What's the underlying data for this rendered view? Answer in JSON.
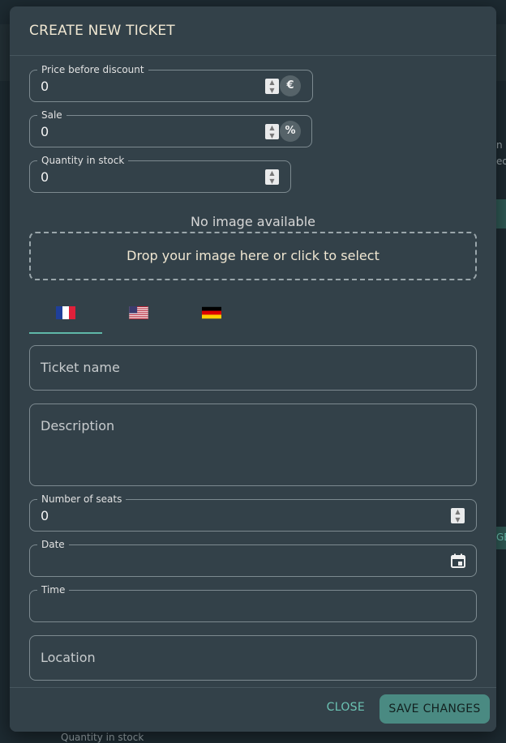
{
  "background": {
    "bottom_peek_label": "Quantity in stock",
    "right_peek_1": "n i",
    "right_peek_2": "ed",
    "right_peek_3": "GE"
  },
  "modal": {
    "title": "CREATE NEW TICKET",
    "price": {
      "label": "Price before discount",
      "value": "0",
      "adornment": "€"
    },
    "sale": {
      "label": "Sale",
      "value": "0",
      "adornment": "%"
    },
    "quantity": {
      "label": "Quantity in stock",
      "value": "0"
    },
    "no_image_text": "No image available",
    "dropzone_text": "Drop your image here or click to select",
    "language_tabs": [
      {
        "flag": "france-flag-icon",
        "active": true
      },
      {
        "flag": "usa-flag-icon",
        "active": false
      },
      {
        "flag": "germany-flag-icon",
        "active": false
      }
    ],
    "ticket_name_placeholder": "Ticket name",
    "description_placeholder": "Description",
    "seats": {
      "label": "Number of seats",
      "value": "0"
    },
    "date": {
      "label": "Date",
      "value": "",
      "icon": "calendar-icon"
    },
    "time": {
      "label": "Time",
      "value": ""
    },
    "location_placeholder": "Location",
    "close_label": "CLOSE",
    "save_label": "SAVE CHANGES"
  },
  "colors": {
    "accent": "#5fb8a8",
    "save_button": "#4a8a82",
    "modal_bg": "#334149",
    "title": "#f0e7d2"
  }
}
